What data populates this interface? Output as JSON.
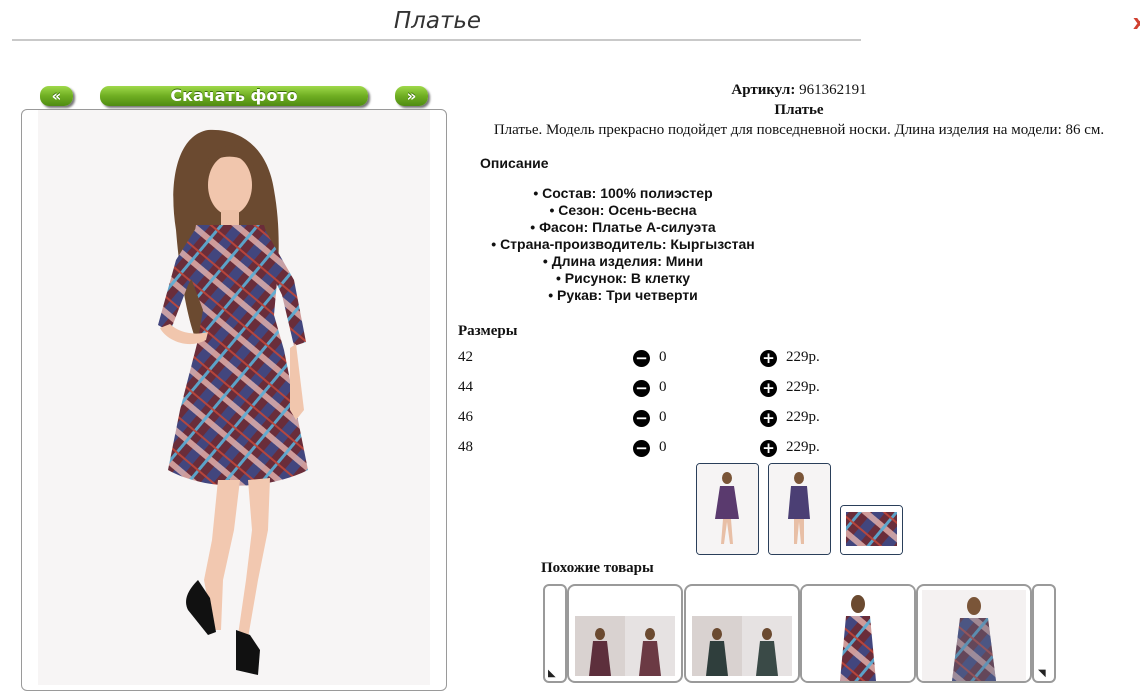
{
  "header": {
    "title": "Платье",
    "close_glyph": "x"
  },
  "photo_nav": {
    "prev_label": "«",
    "download_label": "Скачать фото",
    "next_label": "»"
  },
  "product": {
    "article_label": "Артикул:",
    "article_value": "961362191",
    "name": "Платье",
    "description": "Платье. Модель прекрасно подойдет для повседневной носки. Длина изделия на модели: 86 см."
  },
  "details": {
    "heading": "Описание",
    "properties": [
      "Состав: 100% полиэстер",
      "Сезон: Осень-весна",
      "Фасон: Платье А-силуэта",
      "Страна-производитель: Кыргызстан",
      "Длина изделия: Мини",
      "Рисунок: В клетку",
      "Рукав: Три четверти"
    ]
  },
  "sizes": {
    "heading": "Размеры",
    "rows": [
      {
        "size": "42",
        "qty": "0",
        "price": "229р."
      },
      {
        "size": "44",
        "qty": "0",
        "price": "229р."
      },
      {
        "size": "46",
        "qty": "0",
        "price": "229р."
      },
      {
        "size": "48",
        "qty": "0",
        "price": "229р."
      }
    ],
    "minus_glyph": "−",
    "plus_glyph": "+"
  },
  "similar": {
    "heading": "Похожие товары"
  },
  "colors": {
    "button_green": "#6fae22",
    "border": "#9a9a9a",
    "thumb_border": "#2a3f5a"
  },
  "icons": [
    "minus-circle-icon",
    "plus-circle-icon",
    "resize-corner-icon"
  ]
}
